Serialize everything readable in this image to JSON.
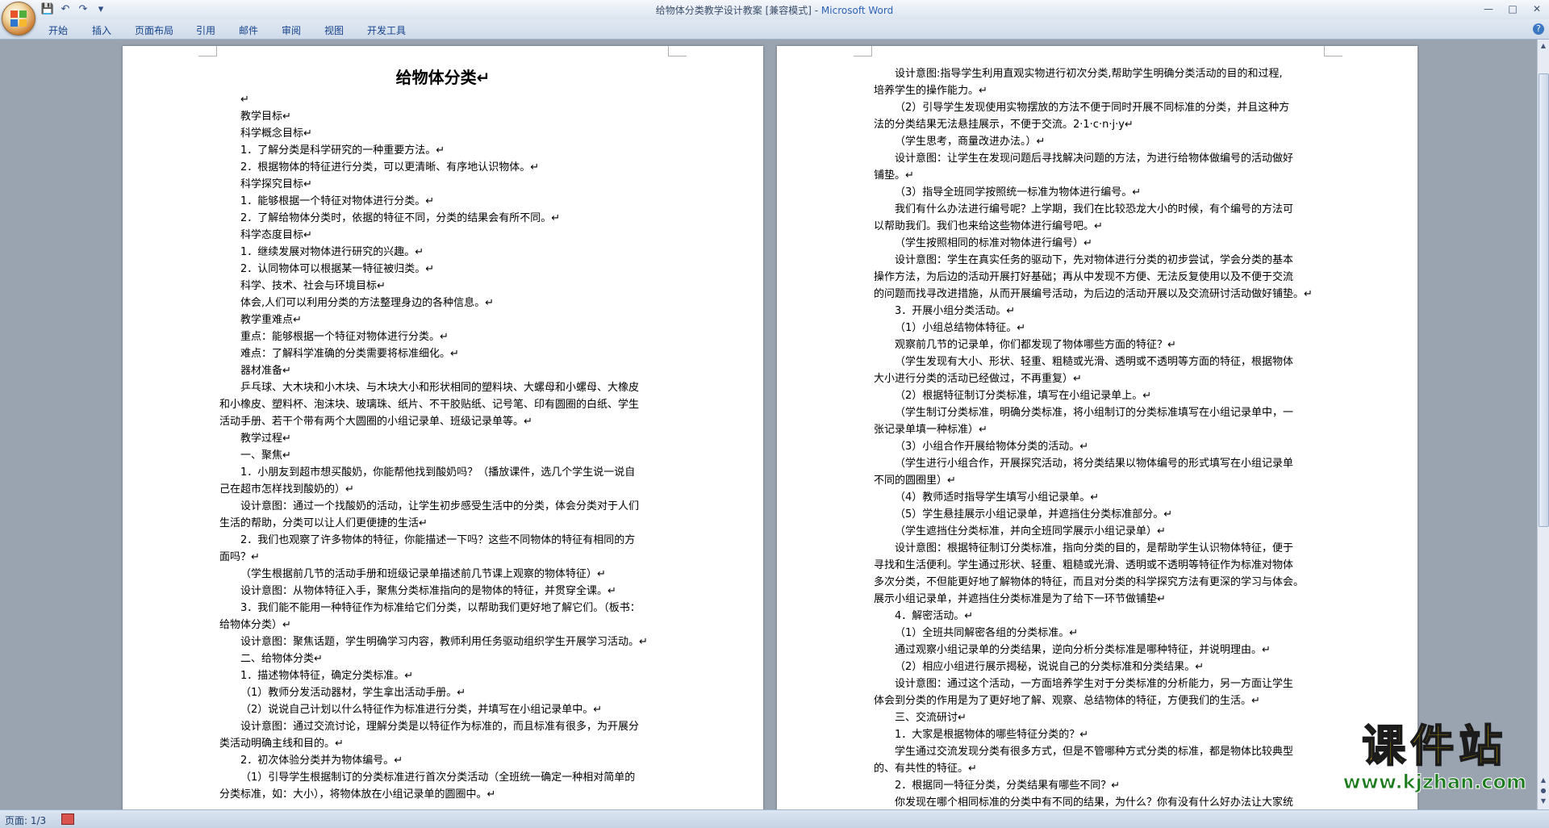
{
  "window": {
    "title": "给物体分类教学设计教案 [兼容模式] - ",
    "app_name": "Microsoft Word"
  },
  "ribbon": {
    "tabs": [
      "开始",
      "插入",
      "页面布局",
      "引用",
      "邮件",
      "审阅",
      "视图",
      "开发工具"
    ]
  },
  "statusbar": {
    "page": "页面: 1/3"
  },
  "watermark": {
    "name": "课件站",
    "url": "www.kjzhan.com"
  },
  "page1": {
    "title": "给物体分类↵",
    "lines": [
      "↵",
      "教学目标↵",
      "科学概念目标↵",
      "1．了解分类是科学研究的一种重要方法。↵",
      "2．根据物体的特征进行分类，可以更清晰、有序地认识物体。↵",
      "科学探究目标↵",
      "1．能够根据一个特征对物体进行分类。↵",
      "2．了解给物体分类时，依据的特征不同，分类的结果会有所不同。↵",
      "科学态度目标↵",
      "1．继续发展对物体进行研究的兴趣。↵",
      "2．认同物体可以根据某一特征被归类。↵",
      "科学、技术、社会与环境目标↵",
      "体会,人们可以利用分类的方法整理身边的各种信息。↵",
      "教学重难点↵",
      "重点：能够根据一个特征对物体进行分类。↵",
      "难点：了解科学准确的分类需要将标准细化。↵",
      "器材准备↵",
      "乒乓球、大木块和小木块、与木块大小和形状相同的塑料块、大螺母和小螺母、大橡皮",
      "和小橡皮、塑料杯、泡沫块、玻璃珠、纸片、不干胶贴纸、记号笔、印有圆圈的白纸、学生",
      "活动手册、若干个带有两个大圆圈的小组记录单、班级记录单等。↵",
      "教学过程↵",
      "一、聚焦↵",
      "1．小朋友到超市想买酸奶，你能帮他找到酸奶吗？（播放课件，选几个学生说一说自",
      "己在超市怎样找到酸奶的）↵",
      "设计意图：通过一个找酸奶的活动，让学生初步感受生活中的分类，体会分类对于人们",
      "生活的帮助，分类可以让人们更便捷的生活↵",
      "2．我们也观察了许多物体的特征，你能描述一下吗？这些不同物体的特征有相同的方",
      "面吗？↵",
      "（学生根据前几节的活动手册和班级记录单描述前几节课上观察的物体特征）↵",
      "设计意图：从物体特征入手，聚焦分类标准指向的是物体的特征，并贯穿全课。↵",
      "3．我们能不能用一种特征作为标准给它们分类，以帮助我们更好地了解它们。（板书：",
      "给物体分类）↵",
      "设计意图：聚焦话题，学生明确学习内容，教师利用任务驱动组织学生开展学习活动。↵",
      "二、给物体分类↵",
      "1．描述物体特征，确定分类标准。↵",
      "（1）教师分发活动器材，学生拿出活动手册。↵",
      "（2）说说自己计划以什么特征作为标准进行分类，并填写在小组记录单中。↵",
      "设计意图：通过交流讨论，理解分类是以特征作为标准的，而且标准有很多，为开展分",
      "类活动明确主线和目的。↵",
      "2．初次体验分类并为物体编号。↵",
      "（1）引导学生根据制订的分类标准进行首次分类活动（全班统一确定一种相对简单的",
      "分类标准，如：大小），将物体放在小组记录单的圆圈中。↵"
    ]
  },
  "page2": {
    "lines": [
      "设计意图:指导学生利用直观实物进行初次分类,帮助学生明确分类活动的目的和过程,",
      "培养学生的操作能力。↵",
      "（2）引导学生发现使用实物摆放的方法不便于同时开展不同标准的分类，并且这种方",
      "法的分类结果无法悬挂展示，不便于交流。2·1·c·n·j·y↵",
      "（学生思考，商量改进办法。）↵",
      "设计意图：让学生在发现问题后寻找解决问题的方法，为进行给物体做编号的活动做好",
      "铺垫。↵",
      "（3）指导全班同学按照统一标准为物体进行编号。↵",
      "我们有什么办法进行编号呢？上学期，我们在比较恐龙大小的时候，有个编号的方法可",
      "以帮助我们。我们也来给这些物体进行编号吧。↵",
      "（学生按照相同的标准对物体进行编号）↵",
      "设计意图：学生在真实任务的驱动下，先对物体进行分类的初步尝试，学会分类的基本",
      "操作方法，为后边的活动开展打好基础；再从中发现不方便、无法反复使用以及不便于交流",
      "的问题而找寻改进措施，从而开展编号活动，为后边的活动开展以及交流研讨活动做好铺垫。↵",
      "3．开展小组分类活动。↵",
      "（1）小组总结物体特征。↵",
      "观察前几节的记录单，你们都发现了物体哪些方面的特征？↵",
      "（学生发现有大小、形状、轻重、粗糙或光滑、透明或不透明等方面的特征，根据物体",
      "大小进行分类的活动已经做过，不再重复）↵",
      "（2）根据特征制订分类标准，填写在小组记录单上。↵",
      "（学生制订分类标准，明确分类标准，将小组制订的分类标准填写在小组记录单中，一",
      "张记录单填一种标准）↵",
      "（3）小组合作开展给物体分类的活动。↵",
      "（学生进行小组合作，开展探究活动，将分类结果以物体编号的形式填写在小组记录单",
      "不同的圆圈里）↵",
      "（4）教师适时指导学生填写小组记录单。↵",
      "（5）学生悬挂展示小组记录单，并遮挡住分类标准部分。↵",
      "（学生遮挡住分类标准，并向全班同学展示小组记录单）↵",
      "设计意图：根据特征制订分类标准，指向分类的目的，是帮助学生认识物体特征，便于",
      "寻找和生活便利。学生通过形状、轻重、粗糙或光滑、透明或不透明等特征作为标准对物体",
      "多次分类，不但能更好地了解物体的特征，而且对分类的科学探究方法有更深的学习与体会。",
      "展示小组记录单，并遮挡住分类标准是为了给下一环节做铺垫↵",
      "4．解密活动。↵",
      "（1）全班共同解密各组的分类标准。↵",
      "通过观察小组记录单的分类结果，逆向分析分类标准是哪种特征，并说明理由。↵",
      "（2）相应小组进行展示揭秘，说说自己的分类标准和分类结果。↵",
      "设计意图：通过这个活动，一方面培养学生对于分类标准的分析能力，另一方面让学生",
      "体会到分类的作用是为了更好地了解、观察、总结物体的特征，方便我们的生活。↵",
      "三、交流研讨↵",
      "1．大家是根据物体的哪些特征分类的？↵",
      "学生通过交流发现分类有很多方式，但是不管哪种方式分类的标准，都是物体比较典型",
      "的、有共性的特征。↵",
      "2．根据同一特征分类，分类结果有哪些不同？↵",
      "你发现在哪个相同标准的分类中有不同的结果，为什么？你有没有什么好办法让大家统"
    ]
  }
}
